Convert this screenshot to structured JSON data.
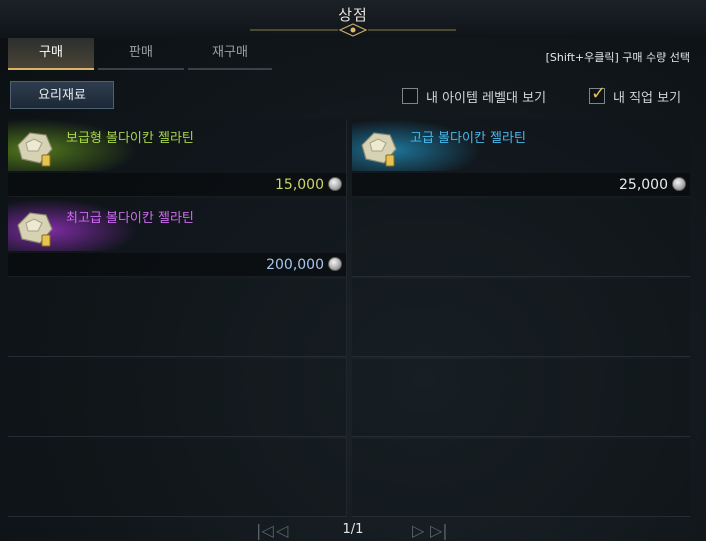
{
  "window": {
    "title": "상점"
  },
  "tabs": [
    {
      "label": "구매",
      "active": true
    },
    {
      "label": "판매",
      "active": false
    },
    {
      "label": "재구매",
      "active": false
    }
  ],
  "hint": "[Shift+우클릭] 구매 수량 선택",
  "filter_button": "요리재료",
  "checkboxes": [
    {
      "label": "내 아이템 레벨대 보기",
      "checked": false
    },
    {
      "label": "내 직업 보기",
      "checked": true
    }
  ],
  "items": [
    {
      "name": "보급형 볼다이칸 젤라틴",
      "price": "15,000",
      "name_color": "#a9d74a",
      "price_color": "#c9d56a",
      "grade_color": "#5e8a1c"
    },
    {
      "name": "고급 볼다이칸 젤라틴",
      "price": "25,000",
      "name_color": "#48b9ec",
      "price_color": "#e9e9e9",
      "grade_color": "#1f7fa8"
    },
    {
      "name": "최고급 볼다이칸 젤라틴",
      "price": "200,000",
      "name_color": "#cf6cf2",
      "price_color": "#a8c4ee",
      "grade_color": "#8a2eb4"
    }
  ],
  "pager": {
    "text": "1/1",
    "first_icon": "first-page-icon",
    "prev_icon": "prev-page-icon",
    "next_icon": "next-page-icon",
    "last_icon": "last-page-icon"
  }
}
